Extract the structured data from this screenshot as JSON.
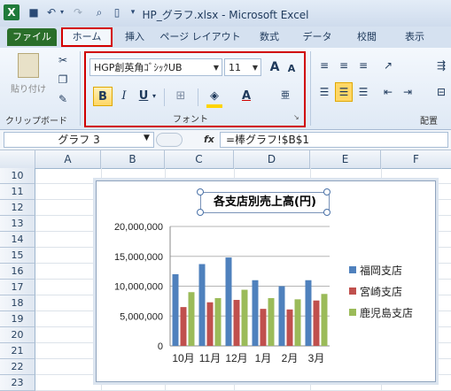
{
  "window": {
    "title": "HP_グラフ.xlsx - Microsoft Excel",
    "app_icon": "X"
  },
  "tabs": [
    "ファイル",
    "ホーム",
    "挿入",
    "ページ レイアウト",
    "数式",
    "データ",
    "校閲",
    "表示"
  ],
  "ribbon": {
    "clipboard": {
      "paste_label": "貼り付け",
      "group_label": "クリップボード"
    },
    "font": {
      "group_label": "フォント",
      "font_name": "HGP創英角ｺﾞｼｯｸUB",
      "font_size": "11",
      "grow_label": "A",
      "shrink_label": "A",
      "bold_label": "B",
      "italic_label": "I",
      "underline_label": "U",
      "font_color_label": "A",
      "phonetic_label": "亜"
    },
    "alignment": {
      "group_label": "配置"
    }
  },
  "formula_bar": {
    "name_box": "グラフ 3",
    "fx_label": "fx",
    "formula": "=棒グラフ!$B$1"
  },
  "columns": [
    "A",
    "B",
    "C",
    "D",
    "E",
    "F"
  ],
  "rows": [
    "10",
    "11",
    "12",
    "13",
    "14",
    "15",
    "16",
    "17",
    "18",
    "19",
    "20",
    "21",
    "22",
    "23"
  ],
  "chart_data": {
    "type": "bar",
    "title": "各支店別売上高(円)",
    "categories": [
      "10月",
      "11月",
      "12月",
      "1月",
      "2月",
      "3月"
    ],
    "series": [
      {
        "name": "福岡支店",
        "color": "#4f81bd",
        "values": [
          12000000,
          13700000,
          14800000,
          11000000,
          10000000,
          11000000
        ]
      },
      {
        "name": "宮崎支店",
        "color": "#c0504d",
        "values": [
          6500000,
          7300000,
          7700000,
          6200000,
          6100000,
          7600000
        ]
      },
      {
        "name": "鹿児島支店",
        "color": "#9bbb59",
        "values": [
          9000000,
          8000000,
          9400000,
          8000000,
          7800000,
          8700000
        ]
      }
    ],
    "yticks": [
      "0",
      "5,000,000",
      "10,000,000",
      "15,000,000",
      "20,000,000"
    ],
    "ylim": [
      0,
      20000000
    ],
    "grid": true,
    "legend": "right"
  }
}
